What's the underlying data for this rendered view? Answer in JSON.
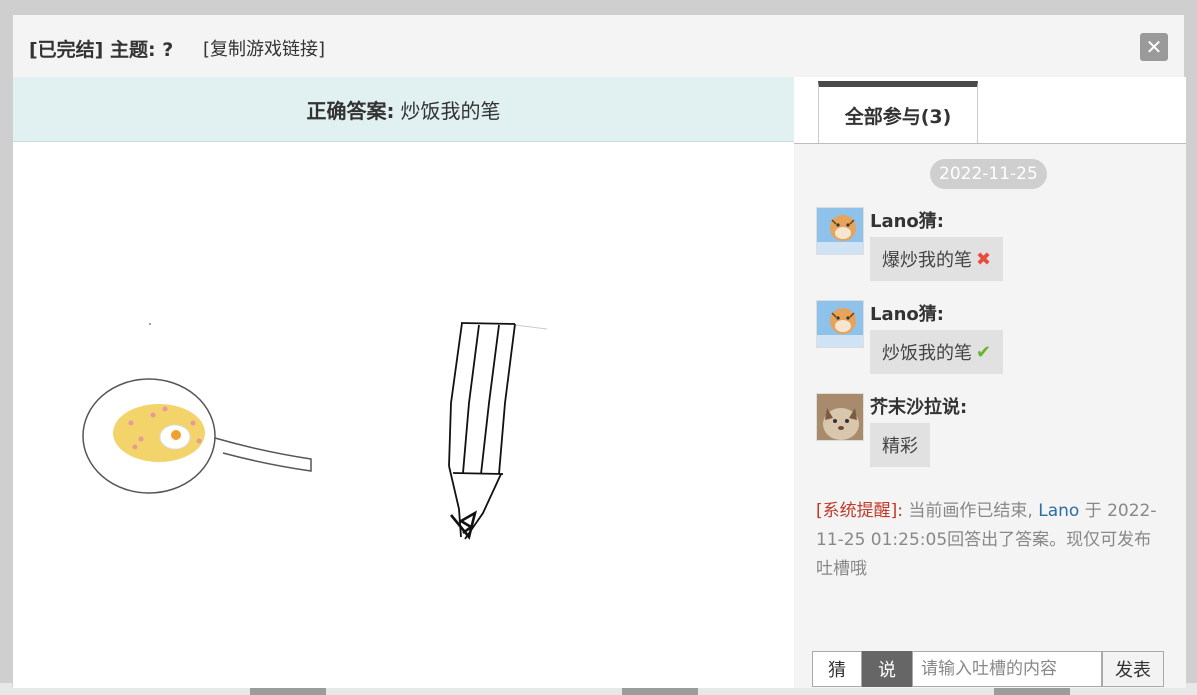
{
  "header": {
    "status": "[已完结]",
    "topic": "主题: ?",
    "copy_link": "[复制游戏链接]",
    "close_icon": "close-icon"
  },
  "answer": {
    "label": "正确答案:",
    "value": "炒饭我的笔"
  },
  "tabs": [
    {
      "label": "全部参与(3)",
      "active": true
    }
  ],
  "chat": {
    "date": "2022-11-25",
    "messages": [
      {
        "name": "Lano猜:",
        "text": "爆炒我的笔",
        "result": "wrong",
        "icon": "cross-icon",
        "avatar": "tiger-avatar"
      },
      {
        "name": "Lano猜:",
        "text": "炒饭我的笔",
        "result": "correct",
        "icon": "check-icon",
        "avatar": "tiger-avatar"
      },
      {
        "name": "芥末沙拉说:",
        "text": "精彩",
        "result": "none",
        "icon": "",
        "avatar": "cat-avatar"
      }
    ],
    "system": {
      "tag": "[系统提醒]:",
      "before": " 当前画作已结束, ",
      "user": "Lano",
      "after": " 于 2022-11-25 01:25:05回答出了答案。现仅可发布吐槽哦"
    }
  },
  "input": {
    "mode_guess": "猜",
    "mode_say": "说",
    "active_mode": "说",
    "placeholder": "请输入吐槽的内容",
    "send": "发表"
  },
  "colors": {
    "answer_bg": "#e1f1f1",
    "wrong": "#e84c3d",
    "correct": "#6ab42a",
    "system_tag": "#c0392b",
    "user_link": "#2e6da4"
  }
}
